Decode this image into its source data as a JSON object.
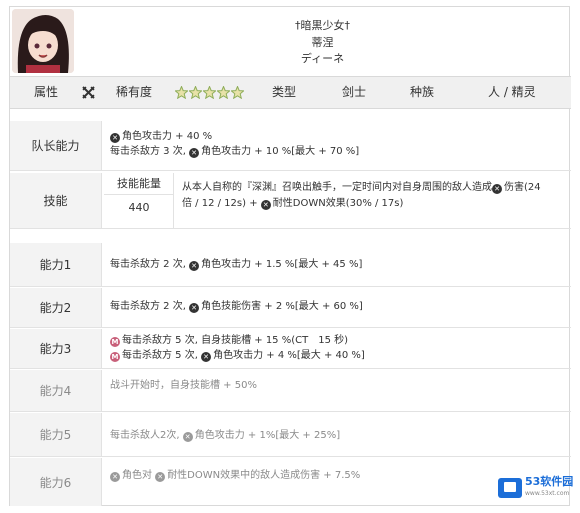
{
  "header": {
    "title_line1": "†暗黒少女†",
    "title_line2": "蒂涅",
    "title_line3": "ディーネ"
  },
  "attributes": {
    "attr_label": "属性",
    "attr_icon": "crossed-swords-icon",
    "rarity_label": "稀有度",
    "rarity_stars": 5,
    "type_label": "类型",
    "type_value": "剑士",
    "race_label": "种族",
    "race_value": "人 / 精灵"
  },
  "rows": {
    "leader": {
      "label": "队长能力",
      "line1": "角色攻击力 + 40 %",
      "line2_prefix": "每击杀敌方 3 次,",
      "line2_suffix": "角色攻击力 + 10 %[最大 + 70 %]"
    },
    "skill": {
      "label": "技能",
      "energy_label": "技能能量",
      "energy_value": "440",
      "line1_prefix": "从本人自称的『深渊』召唤出触手，一定时间内对自身周围的敌人造成",
      "line1_suffix": "伤害(24",
      "line2_prefix": "倍 / 12 / 12s) +",
      "line2_suffix": "耐性DOWN效果(30% / 17s)"
    },
    "ability1": {
      "label": "能力1",
      "prefix": "每击杀敌方 2 次,",
      "suffix": "角色攻击力 + 1.5 %[最大 + 45 %]"
    },
    "ability2": {
      "label": "能力2",
      "prefix": "每击杀敌方 2 次,",
      "suffix": "角色技能伤害 + 2 %[最大 + 60 %]"
    },
    "ability3": {
      "label": "能力3",
      "line1": "每击杀敌方 5 次, 自身技能槽 + 15 %(CT　15 秒)",
      "line2_prefix": "每击杀敌方 5 次,",
      "line2_suffix": "角色攻击力 + 4 %[最大 + 40 %]"
    },
    "ability4": {
      "label": "能力4",
      "text": "战斗开始时，自身技能槽 + 50%"
    },
    "ability5": {
      "label": "能力5",
      "prefix": "每击杀敌人2次,",
      "suffix": "角色攻击力 + 1%[最大 + 25%]"
    },
    "ability6": {
      "label": "能力6",
      "part1": "角色对",
      "part2": "耐性DOWN效果中的敌人造成伤害 + 7.5%"
    }
  },
  "watermark": {
    "brand": "53软件园",
    "sub": "www.53xt.com"
  },
  "colors": {
    "label_bg": "#f3f3f3",
    "attr_bg": "#f0f0f0",
    "border": "#d9d9d9",
    "badge_pink": "#c8607a",
    "watermark_blue": "#1c6ed8"
  }
}
